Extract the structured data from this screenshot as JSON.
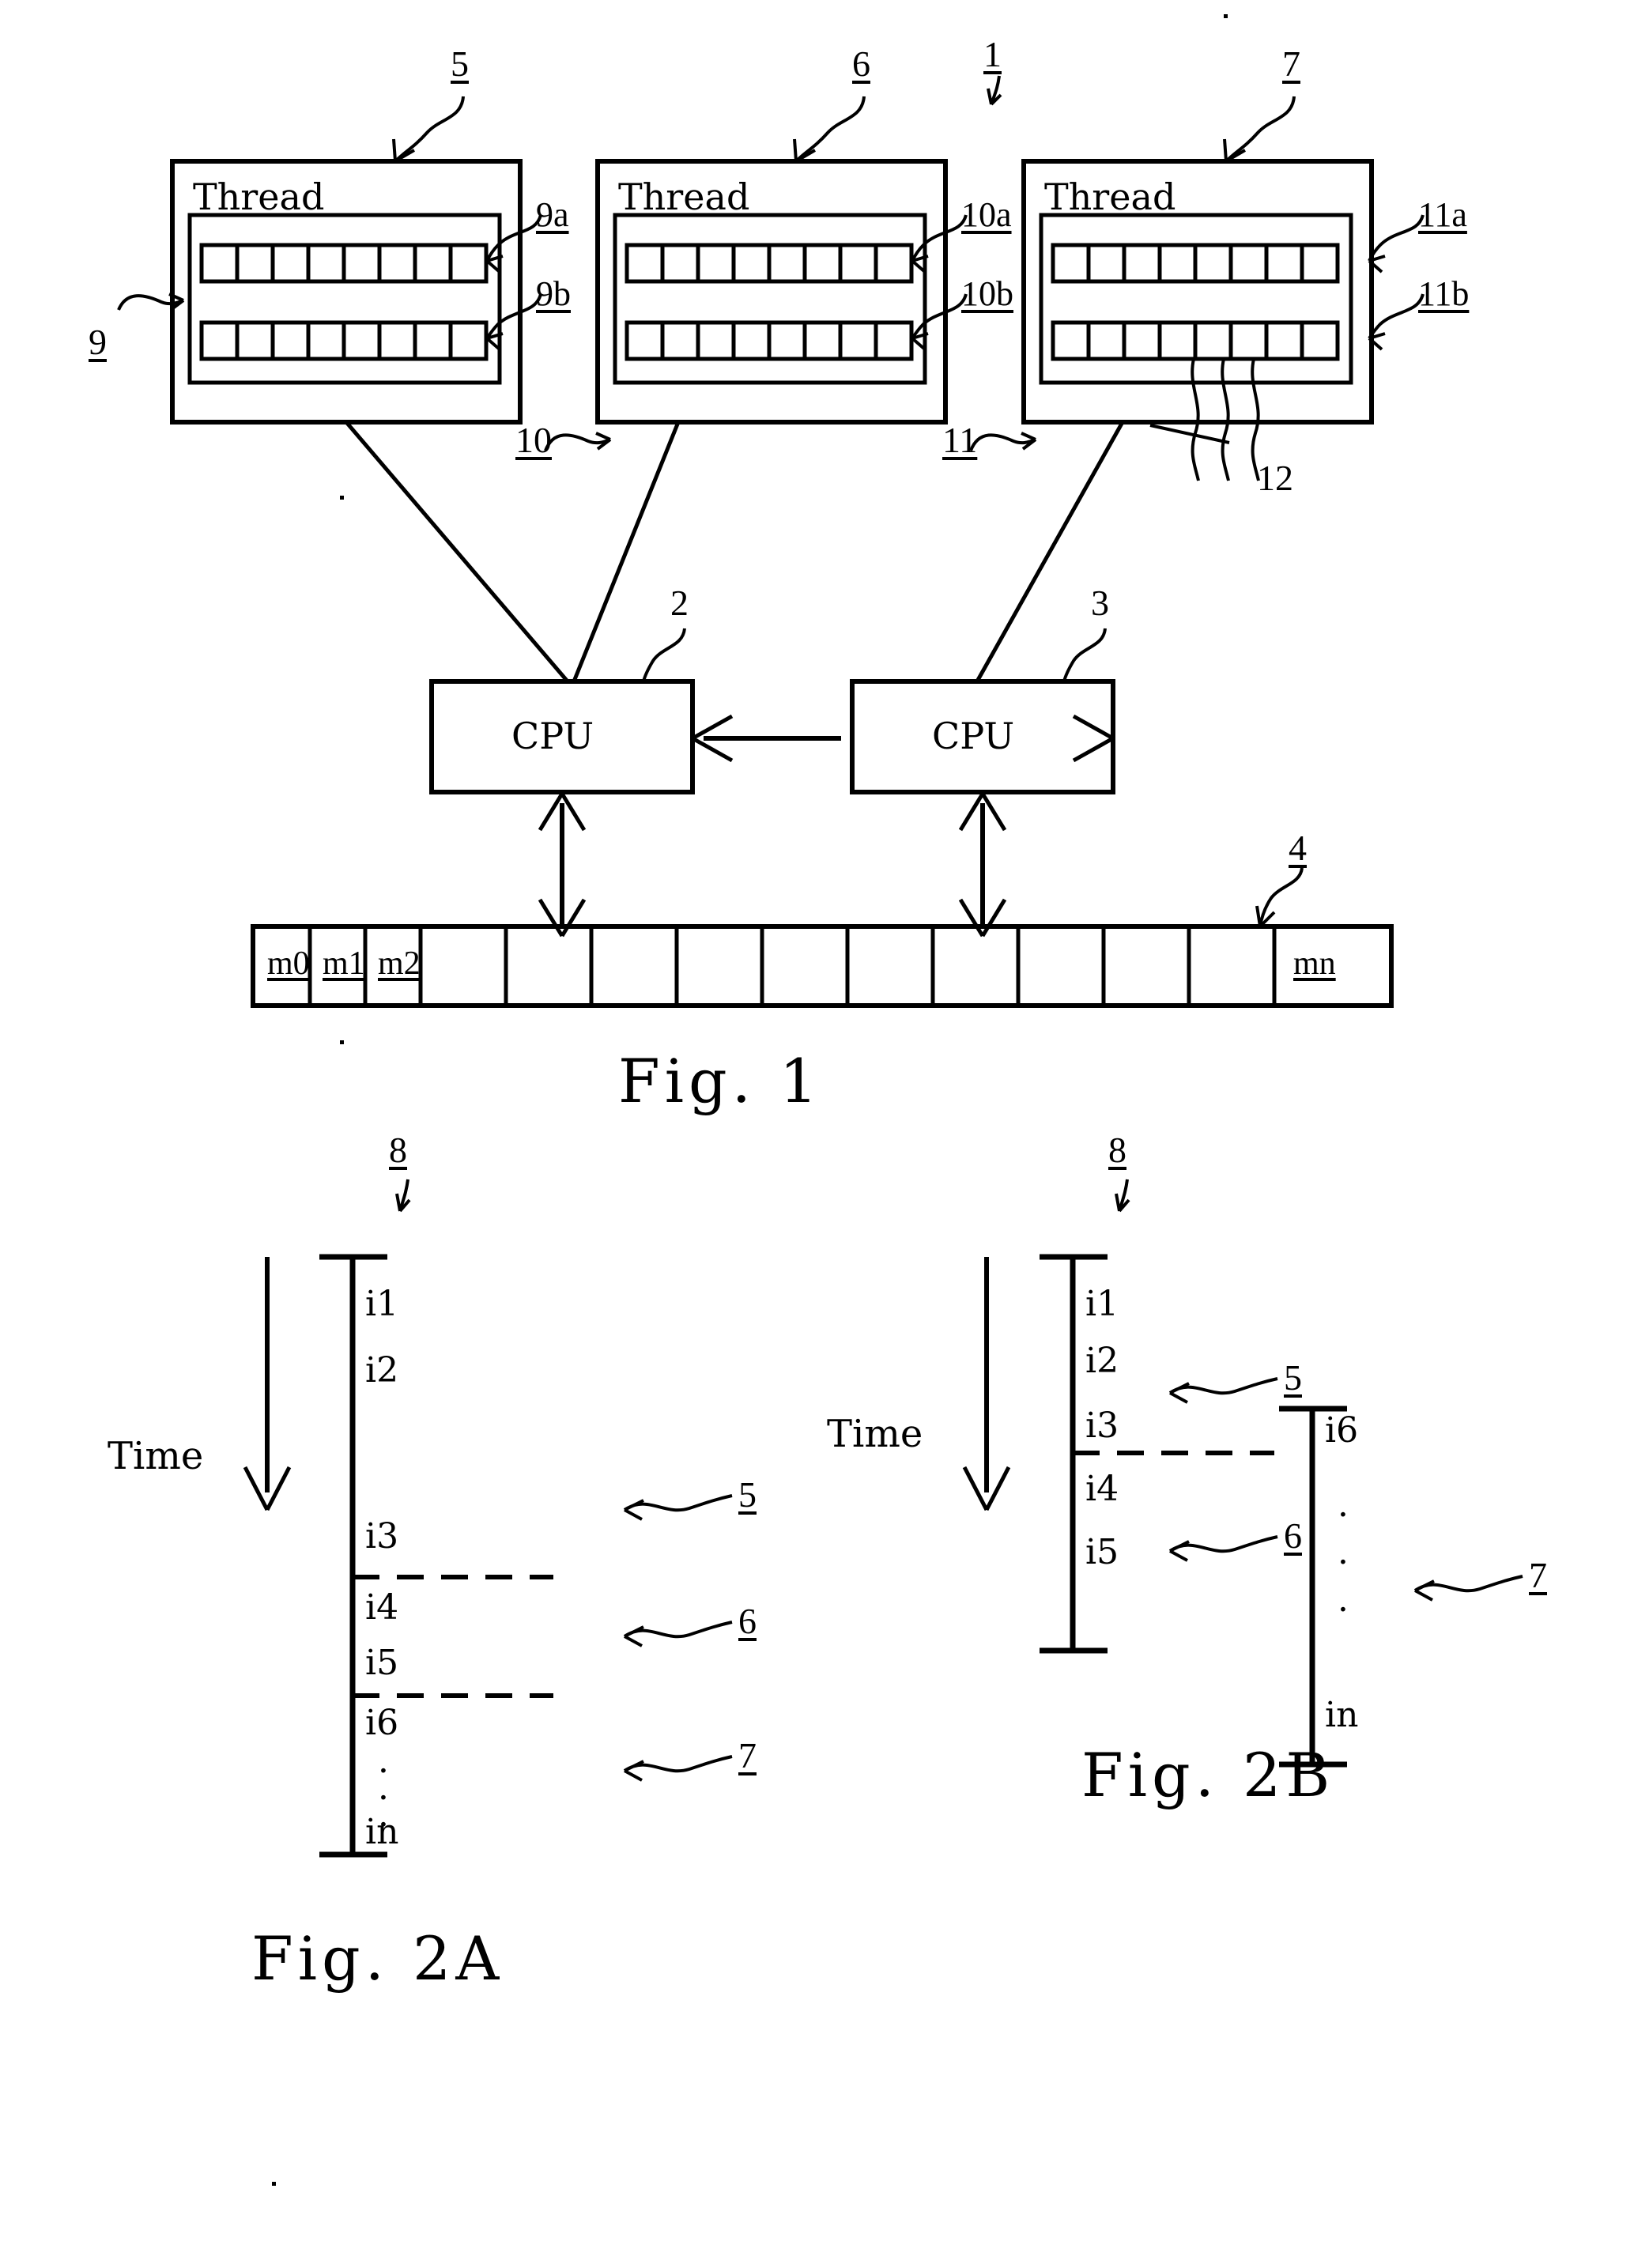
{
  "document": {
    "kind": "patent-drawing-sheet",
    "figures": [
      "Fig. 1",
      "Fig. 2A",
      "Fig. 2B"
    ]
  },
  "fig1": {
    "caption": "Fig. 1",
    "system_ref": "1",
    "threads": [
      {
        "ref": "5",
        "title": "Thread",
        "inner_ref": "9",
        "row_a_ref": "9a",
        "row_b_ref": "9b",
        "cells_per_row": 8
      },
      {
        "ref": "6",
        "title": "Thread",
        "inner_ref": "10",
        "row_a_ref": "10a",
        "row_b_ref": "10b",
        "cells_per_row": 8
      },
      {
        "ref": "7",
        "title": "Thread",
        "inner_ref": "11",
        "row_a_ref": "11a",
        "row_b_ref": "11b",
        "cells_per_row": 8,
        "extra_ref": "12"
      }
    ],
    "cpus": [
      {
        "label": "CPU",
        "ref": "2"
      },
      {
        "label": "CPU",
        "ref": "3"
      }
    ],
    "memory": {
      "ref": "4",
      "cells": [
        "m0",
        "m1",
        "m2",
        "",
        "",
        "",
        "",
        "",
        "",
        "",
        "",
        "",
        "mn"
      ]
    }
  },
  "fig2a": {
    "caption": "Fig. 2A",
    "stream_ref": "8",
    "time_label": "Time",
    "instructions": [
      "i1",
      "i2",
      "i3",
      "i4",
      "i5",
      "i6",
      "in"
    ],
    "ellipsis": "·",
    "segment_refs": [
      "5",
      "6",
      "7"
    ],
    "dashed_splits": 2
  },
  "fig2b": {
    "caption": "Fig. 2B",
    "stream_ref": "8",
    "time_label": "Time",
    "left_instructions": [
      "i1",
      "i2",
      "i3",
      "i4",
      "i5"
    ],
    "right_instructions": [
      "i6",
      "in"
    ],
    "ellipsis": "·",
    "segment_refs": [
      "5",
      "6",
      "7"
    ],
    "dashed_splits": 1
  },
  "colors": {
    "ink": "#000000",
    "paper": "#ffffff"
  }
}
